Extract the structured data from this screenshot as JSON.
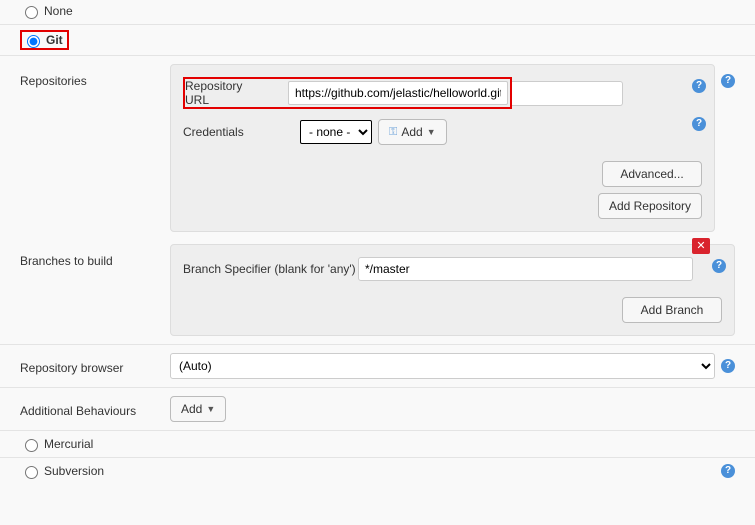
{
  "scm": {
    "none_label": "None",
    "git_label": "Git",
    "mercurial_label": "Mercurial",
    "subversion_label": "Subversion",
    "selected": "git"
  },
  "repositories": {
    "section_label": "Repositories",
    "repo_url_label": "Repository URL",
    "repo_url_value": "https://github.com/jelastic/helloworld.git",
    "credentials_label": "Credentials",
    "credentials_value": "- none -",
    "add_cred_label": "Add",
    "advanced_label": "Advanced...",
    "add_repo_label": "Add Repository"
  },
  "branches": {
    "section_label": "Branches to build",
    "specifier_label": "Branch Specifier (blank for 'any')",
    "specifier_value": "*/master",
    "add_branch_label": "Add Branch"
  },
  "repo_browser": {
    "label": "Repository browser",
    "value": "(Auto)"
  },
  "additional": {
    "label": "Additional Behaviours",
    "add_label": "Add"
  },
  "icons": {
    "help": "?",
    "close": "✕",
    "key": "⚿",
    "caret": "▼"
  }
}
